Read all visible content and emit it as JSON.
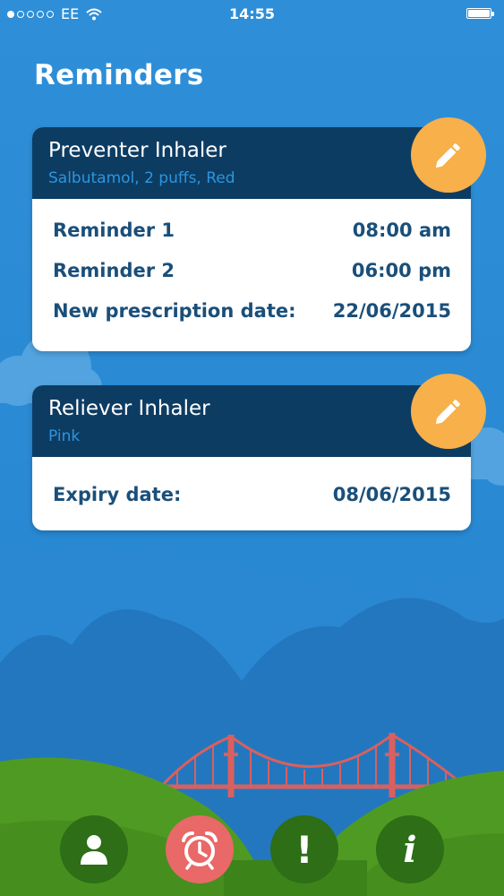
{
  "status_bar": {
    "carrier": "EE",
    "time": "14:55",
    "signal_filled": 1,
    "signal_total": 5
  },
  "page": {
    "title": "Reminders"
  },
  "cards": [
    {
      "title": "Preventer Inhaler",
      "subtitle": "Salbutamol, 2 puffs, Red",
      "rows": [
        {
          "label": "Reminder 1",
          "value": "08:00 am"
        },
        {
          "label": "Reminder 2",
          "value": "06:00 pm"
        },
        {
          "label": "New prescription date:",
          "value": "22/06/2015"
        }
      ]
    },
    {
      "title": "Reliever Inhaler",
      "subtitle": "Pink",
      "rows": [
        {
          "label": "Expiry date:",
          "value": "08/06/2015"
        }
      ]
    }
  ],
  "bottom_nav": [
    {
      "icon": "person-icon",
      "active": false
    },
    {
      "icon": "alarm-clock-icon",
      "active": true
    },
    {
      "icon": "exclamation-icon",
      "active": false
    },
    {
      "icon": "info-icon",
      "active": false
    }
  ],
  "colors": {
    "sky": "#2c8fd6",
    "card_header": "#0d3c63",
    "subtitle": "#2d95dd",
    "row_text": "#1a4f7a",
    "edit_button": "#f7b04a",
    "active_nav": "#e96868",
    "grass": "#4f9a23",
    "bridge": "#d9605e"
  }
}
